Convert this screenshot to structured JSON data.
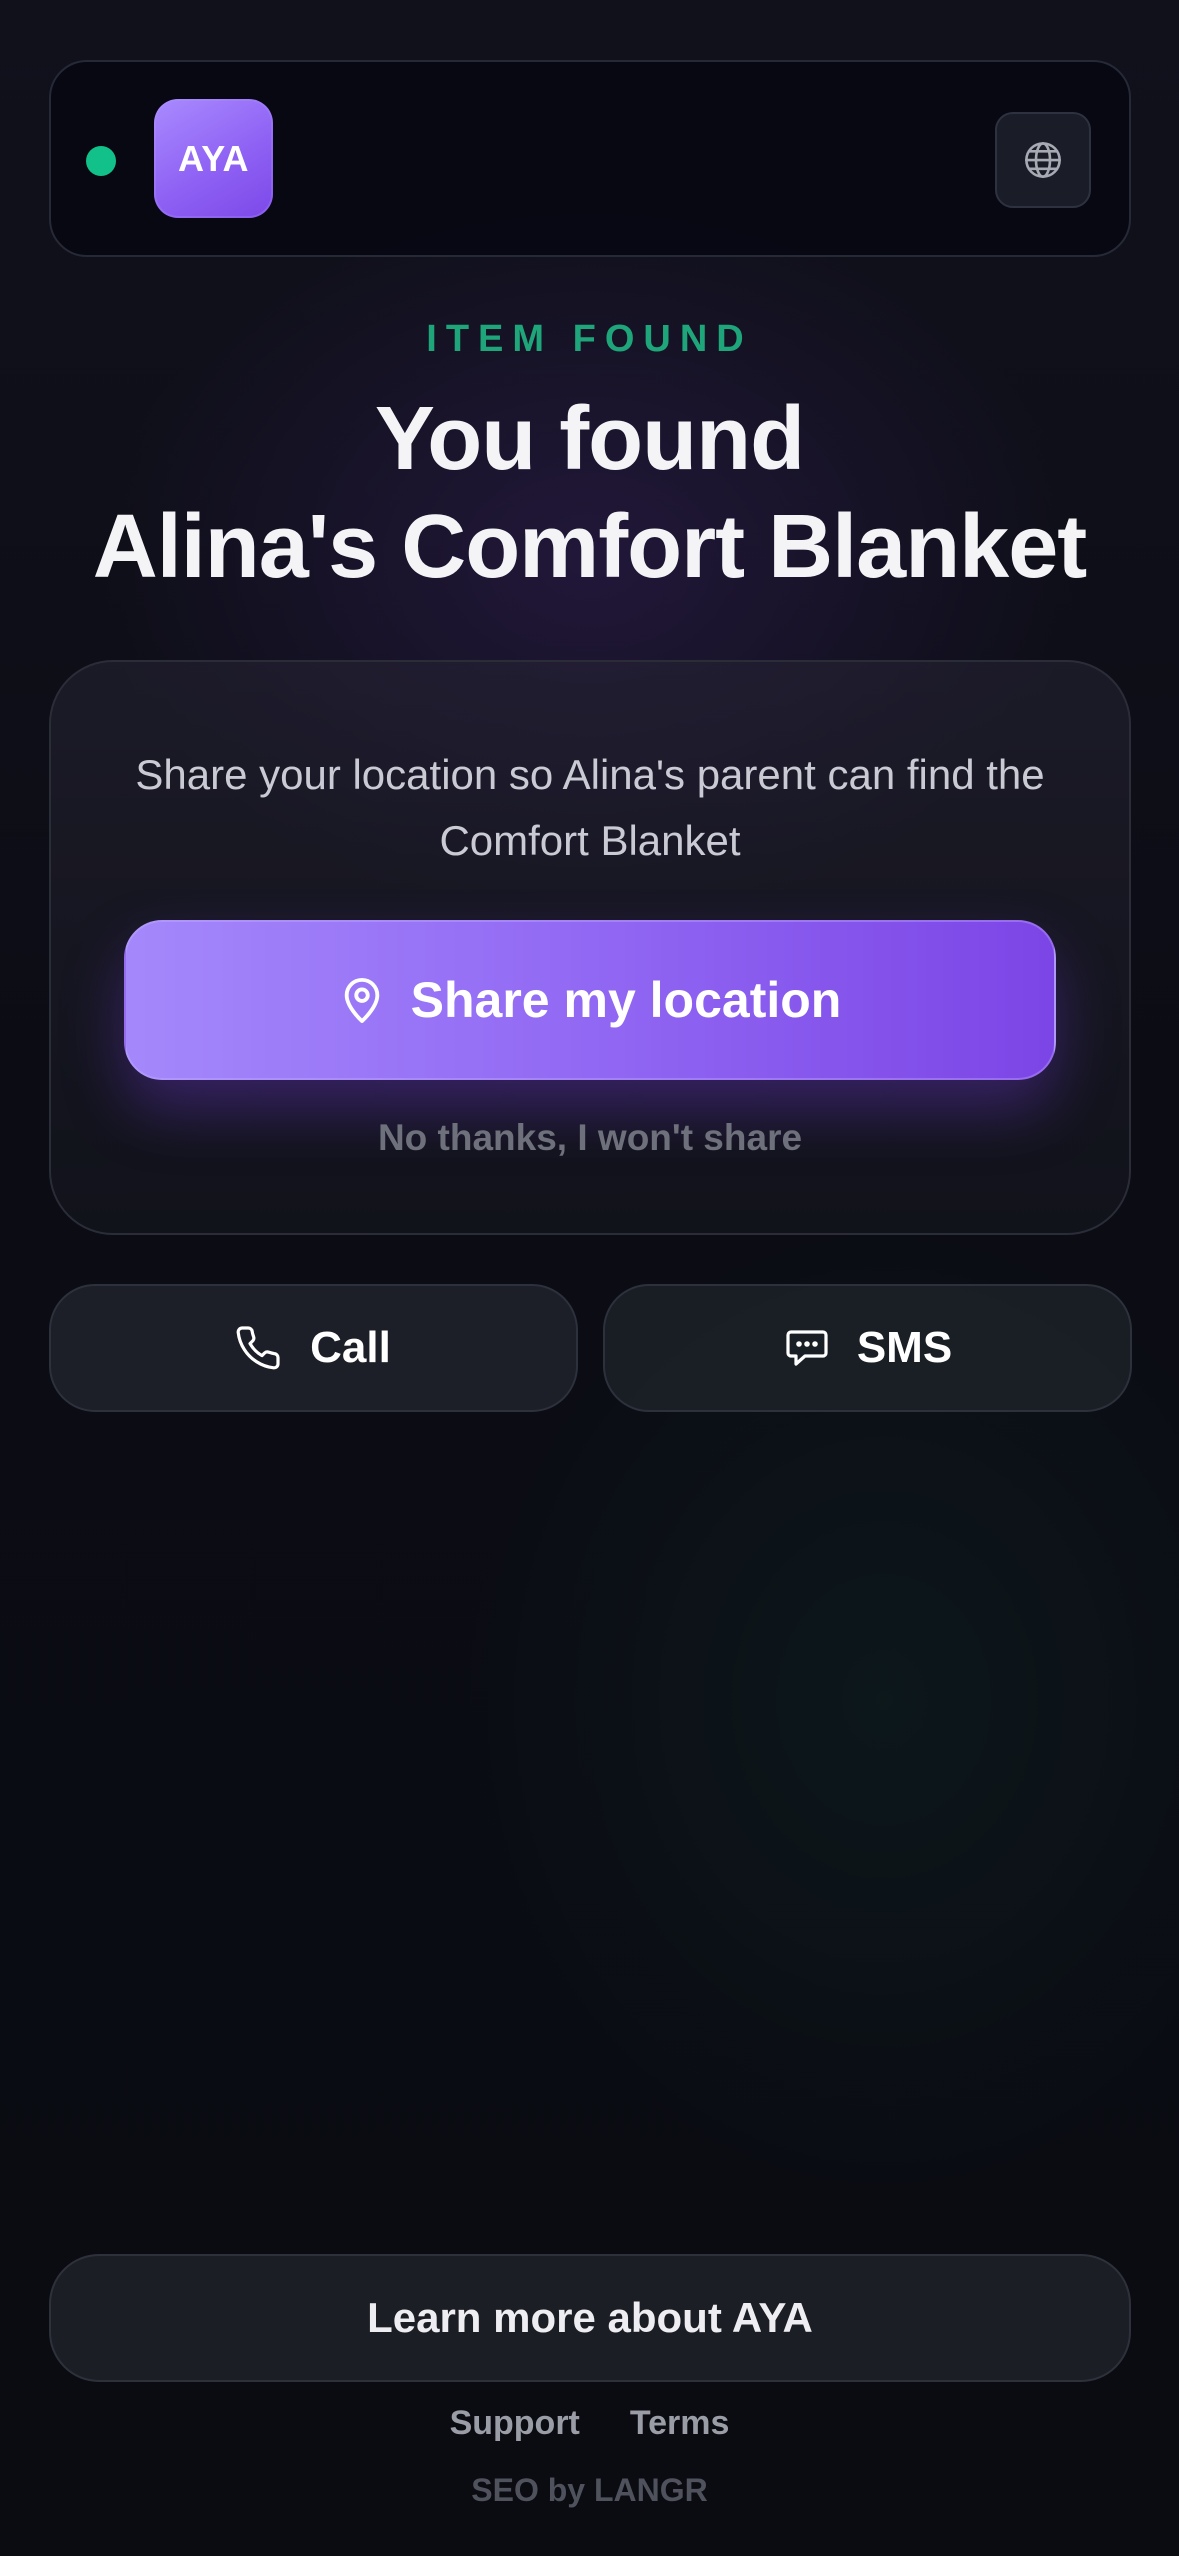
{
  "header": {
    "logo_text": "AYA",
    "status": "online",
    "language_button_icon": "globe-icon"
  },
  "hero": {
    "eyebrow": "ITEM FOUND",
    "title_line1": "You found",
    "title_line2": "Alina's Comfort Blanket"
  },
  "location_card": {
    "message": "Share your location so Alina's parent can find the Comfort Blanket",
    "share_button_label": "Share my location",
    "share_button_icon": "location-pin-icon",
    "decline_label": "No thanks, I won't share"
  },
  "contact": {
    "call_label": "Call",
    "call_icon": "phone-icon",
    "sms_label": "SMS",
    "sms_icon": "chat-bubble-icon"
  },
  "footer": {
    "learn_more_label": "Learn more about AYA",
    "links": [
      "Support",
      "Terms"
    ],
    "credit": "SEO by LANGR"
  },
  "colors": {
    "accent_green": "#1fa57a",
    "status_dot": "#12c18a",
    "purple_start": "#a488fb",
    "purple_end": "#7c45e6",
    "background": "#0a0b12"
  }
}
